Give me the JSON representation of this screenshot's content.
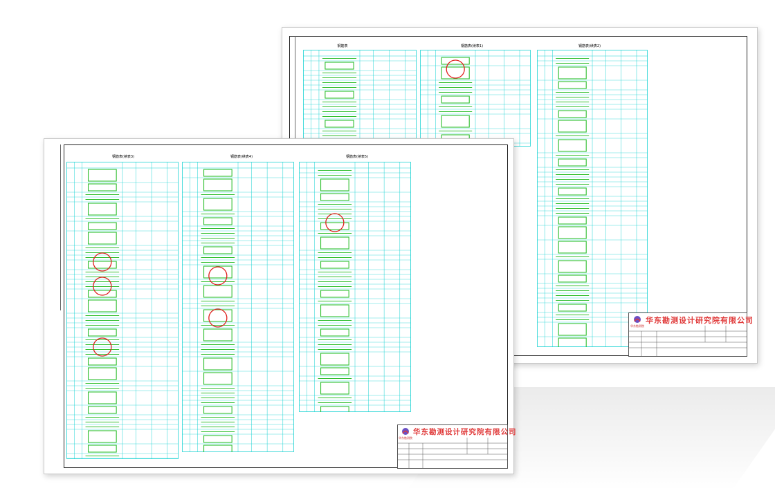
{
  "company_name": "华东勘测设计研究院有限公司",
  "logo_caption": "华东勘测院",
  "back_sheet": {
    "tables": [
      {
        "title": "钢筋表"
      },
      {
        "title": "钢筋表(续表1)"
      },
      {
        "title": "钢筋表(续表2)"
      }
    ]
  },
  "front_sheet": {
    "tables": [
      {
        "title": "钢筋表(续表3)"
      },
      {
        "title": "钢筋表(续表4)"
      },
      {
        "title": "钢筋表(续表5)"
      }
    ]
  },
  "colors": {
    "grid_line": "#19d3d3",
    "rebar_line": "#2fbf2f",
    "marker_circle": "#e0201e",
    "company_text": "#e03a3a",
    "frame": "#222222"
  }
}
